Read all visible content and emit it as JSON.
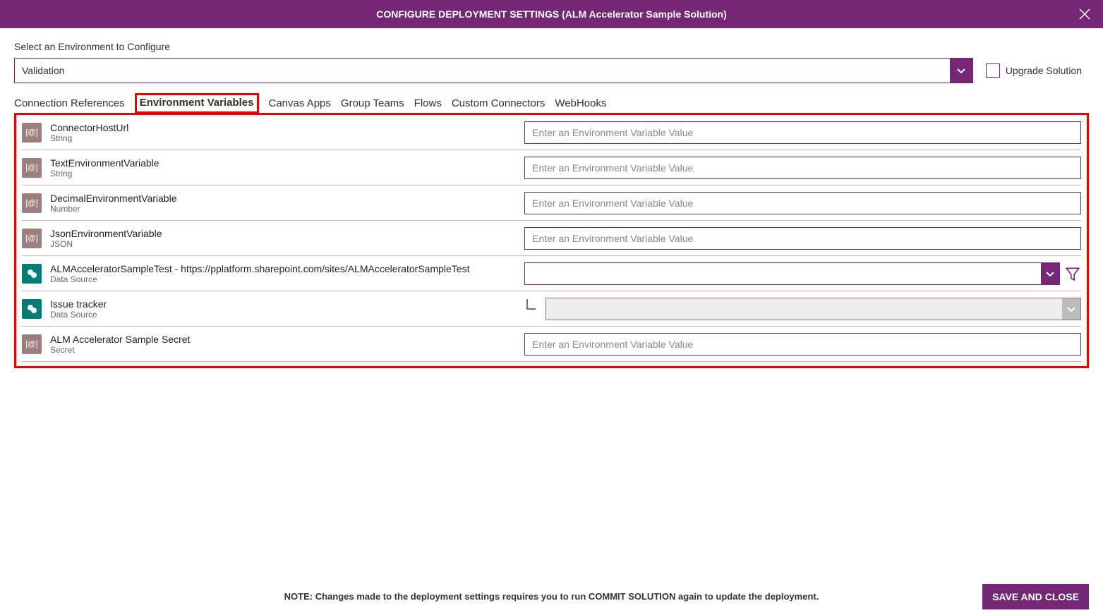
{
  "header": {
    "title": "CONFIGURE DEPLOYMENT SETTINGS (ALM Accelerator Sample Solution)"
  },
  "envSelect": {
    "label": "Select an Environment to Configure",
    "value": "Validation"
  },
  "upgrade": {
    "label": "Upgrade Solution",
    "checked": false
  },
  "tabs": [
    "Connection References",
    "Environment Variables",
    "Canvas Apps",
    "Group Teams",
    "Flows",
    "Custom Connectors",
    "WebHooks"
  ],
  "activeTab": 1,
  "inputPlaceholder": "Enter an Environment Variable Value",
  "vars": [
    {
      "name": "ConnectorHostUrl",
      "type": "String",
      "icon": "brown",
      "control": "text"
    },
    {
      "name": "TextEnvironmentVariable",
      "type": "String",
      "icon": "brown",
      "control": "text"
    },
    {
      "name": "DecimalEnvironmentVariable",
      "type": "Number",
      "icon": "brown",
      "control": "text"
    },
    {
      "name": "JsonEnvironmentVariable",
      "type": "JSON",
      "icon": "brown",
      "control": "text"
    },
    {
      "name": "ALMAcceleratorSampleTest - https://pplatform.sharepoint.com/sites/ALMAcceleratorSampleTest",
      "type": "Data Source",
      "icon": "teal",
      "control": "dropdown-filter"
    },
    {
      "name": "Issue tracker",
      "type": "Data Source",
      "icon": "teal",
      "control": "dropdown-child"
    },
    {
      "name": "ALM Accelerator Sample Secret",
      "type": "Secret",
      "icon": "brown",
      "control": "text"
    }
  ],
  "footer": {
    "note": "NOTE: Changes made to the deployment settings requires you to run COMMIT SOLUTION again to update the deployment.",
    "save": "SAVE AND CLOSE"
  }
}
